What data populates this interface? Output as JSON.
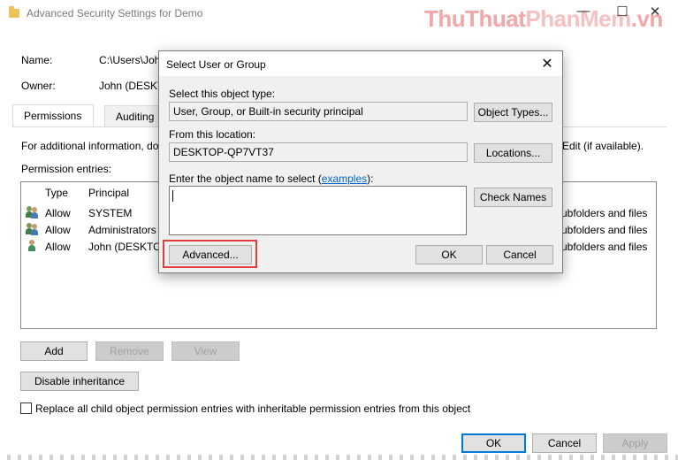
{
  "window": {
    "title": "Advanced Security Settings for Demo",
    "minimize": "—",
    "maximize": "☐",
    "close": "✕"
  },
  "watermark": {
    "part1": "ThuThuat",
    "part2": "PhanMem",
    "part3": ".vn"
  },
  "info": {
    "name_label": "Name:",
    "name_value": "C:\\Users\\John",
    "owner_label": "Owner:",
    "owner_value": "John (DESKTOP"
  },
  "tabs": [
    {
      "label": "Permissions",
      "active": true
    },
    {
      "label": "Auditing",
      "active": false
    }
  ],
  "additional_info_text": "For additional information, do",
  "additional_info_tail": "Edit (if available).",
  "permission_entries_label": "Permission entries:",
  "entries": {
    "headers": {
      "type": "Type",
      "principal": "Principal"
    },
    "rows": [
      {
        "type": "Allow",
        "principal": "SYSTEM",
        "applies": "ubfolders and files",
        "icon": "group-icon"
      },
      {
        "type": "Allow",
        "principal": "Administrators",
        "applies": "ubfolders and files",
        "icon": "group-icon"
      },
      {
        "type": "Allow",
        "principal": "John (DESKTOP",
        "applies": "ubfolders and files",
        "icon": "user-icon"
      }
    ]
  },
  "buttons": {
    "add": "Add",
    "remove": "Remove",
    "view": "View",
    "disable_inheritance": "Disable inheritance",
    "ok": "OK",
    "cancel": "Cancel",
    "apply": "Apply"
  },
  "replace_checkbox": {
    "label": "Replace all child object permission entries with inheritable permission entries from this object",
    "checked": false
  },
  "dialog": {
    "title": "Select User or Group",
    "close": "✕",
    "object_type_label": "Select this object type:",
    "object_type_value": "User, Group, or Built-in security principal",
    "object_types_button": "Object Types...",
    "location_label": "From this location:",
    "location_value": "DESKTOP-QP7VT37",
    "locations_button": "Locations...",
    "enter_name_label_prefix": "Enter the object name to select (",
    "enter_name_link": "examples",
    "enter_name_label_suffix": "):",
    "object_name_value": "",
    "check_names_button": "Check Names",
    "advanced_button": "Advanced...",
    "ok_button": "OK",
    "cancel_button": "Cancel"
  },
  "colors": {
    "accent": "#0078d7",
    "highlight": "#e03c3c",
    "link": "#0066cc"
  }
}
